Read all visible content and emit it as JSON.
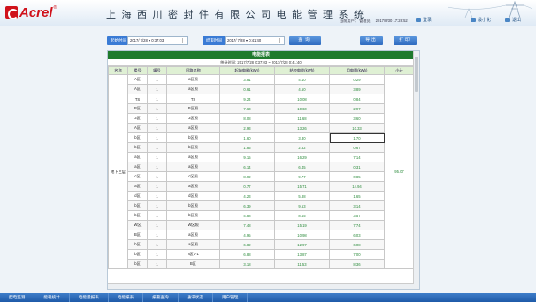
{
  "header": {
    "brand": "Acrel",
    "reg": "®",
    "title": "上海西川密封件有限公司电能管理系统",
    "user": "当前用户：  管理员",
    "datetime": "2017/8/30  17:28:52",
    "buttons": [
      {
        "label": "登录",
        "icon": "login-icon"
      },
      {
        "label": "最小化",
        "icon": "minimize-icon"
      },
      {
        "label": "退出",
        "icon": "exit-icon"
      }
    ]
  },
  "toolbar": {
    "start_label": "起始时间",
    "start_date": "2017/ 7/28 ▾  0:37:03",
    "end_label": "结束时间",
    "end_date": "2017/ 7/28 ▾  0:41:40",
    "query": "查询",
    "export": "导出",
    "print": "打印"
  },
  "report": {
    "title": "电能报表",
    "subtitle": "统计时间: 2017/7/28 0:37:03 ~ 2017/7/28 0:41:40",
    "columns": [
      "名称",
      "楼号",
      "编号",
      "回路名称",
      "起始电能(kWh)",
      "结束电能(kWh)",
      "用电量(kWh)",
      "小计"
    ],
    "group_name": "地下三层",
    "subtotal": "95.07",
    "rows": [
      {
        "b": "A区",
        "n": "1",
        "name": "a区照",
        "s": "3.81",
        "e": "4.10",
        "u": "0.29"
      },
      {
        "b": "A区",
        "n": "1",
        "name": "a区照",
        "s": "0.61",
        "e": "4.50",
        "u": "3.89"
      },
      {
        "b": "TS",
        "n": "1",
        "name": "TS",
        "s": "9.24",
        "e": "10.08",
        "u": "0.84"
      },
      {
        "b": "B区",
        "n": "1",
        "name": "B区照",
        "s": "7.63",
        "e": "10.60",
        "u": "2.97"
      },
      {
        "b": "3区",
        "n": "1",
        "name": "3区照",
        "s": "8.08",
        "e": "11.68",
        "u": "3.60"
      },
      {
        "b": "A区",
        "n": "1",
        "name": "a区照",
        "s": "2.93",
        "e": "13.26",
        "u": "10.33"
      },
      {
        "b": "b区",
        "n": "1",
        "name": "b区照",
        "s": "1.60",
        "e": "3.30",
        "u": "1.70",
        "hl": true
      },
      {
        "b": "b区",
        "n": "1",
        "name": "b区照",
        "s": "1.85",
        "e": "2.52",
        "u": "0.67"
      },
      {
        "b": "a区",
        "n": "1",
        "name": "a区照",
        "s": "9.15",
        "e": "16.29",
        "u": "7.14"
      },
      {
        "b": "a区",
        "n": "1",
        "name": "a区照",
        "s": "6.14",
        "e": "6.45",
        "u": "0.31"
      },
      {
        "b": "c区",
        "n": "1",
        "name": "c区照",
        "s": "8.92",
        "e": "9.77",
        "u": "0.85"
      },
      {
        "b": "a区",
        "n": "1",
        "name": "a区照",
        "s": "0.77",
        "e": "15.71",
        "u": "14.94"
      },
      {
        "b": "d区",
        "n": "1",
        "name": "d区照",
        "s": "4.23",
        "e": "5.88",
        "u": "1.65"
      },
      {
        "b": "b区",
        "n": "1",
        "name": "b区照",
        "s": "6.39",
        "e": "9.53",
        "u": "3.14"
      },
      {
        "b": "b区",
        "n": "1",
        "name": "b区照",
        "s": "4.88",
        "e": "8.45",
        "u": "3.57"
      },
      {
        "b": "W区",
        "n": "1",
        "name": "W区照",
        "s": "7.48",
        "e": "15.19",
        "u": "7.74"
      },
      {
        "b": "B区",
        "n": "1",
        "name": "a区照",
        "s": "4.95",
        "e": "10.98",
        "u": "6.03"
      },
      {
        "b": "b区",
        "n": "1",
        "name": "a区照",
        "s": "6.82",
        "e": "12.97",
        "u": "6.08"
      },
      {
        "b": "b区",
        "n": "1",
        "name": "a区1-1",
        "s": "6.88",
        "e": "13.87",
        "u": "7.00"
      },
      {
        "b": "b区",
        "n": "1",
        "name": "B区",
        "s": "3.18",
        "e": "11.53",
        "u": "8.36"
      }
    ]
  },
  "bottom_nav": [
    "配电监测",
    "能耗统计",
    "电能量报表",
    "电能报表",
    "报警查询",
    "通讯状态",
    "用户管理"
  ]
}
